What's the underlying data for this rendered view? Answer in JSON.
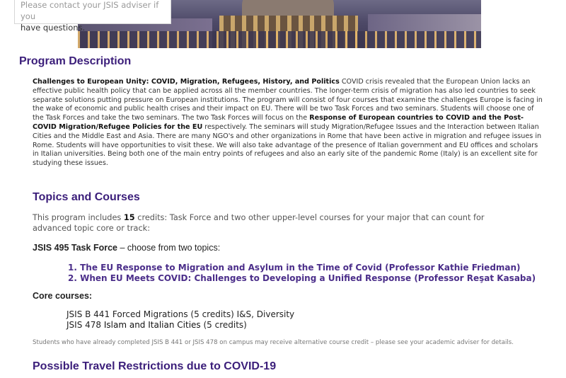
{
  "notice": {
    "line1": "Please contact your JSIS adviser if you",
    "line2": "have questions."
  },
  "program": {
    "title": "Program Description",
    "description": {
      "lead": "Challenges to European Unity: COVID, Migration, Refugees, History, and Politics",
      "p1": " COVID crisis revealed that the European Union lacks an effective public health policy that can be applied across all the member countries. The longer-term crisis of migration has also led countries to seek separate solutions putting pressure on European institutions. The program will consist of four courses that examine the challenges Europe is facing in the wake of economic and public health crises and their impact on EU. There will be two Task Forces and two seminars. Students will choose one of the Task Forces and take the two seminars. The two Task Forces will focus on the ",
      "bold2": "Response of European countries to COVID and the Post-COVID Migration/Refugee Policies for the EU",
      "p2": " respectively. The seminars will study Migration/Refugee Issues and the Interaction between Italian Cities and the Middle East and Asia. There are many NGO's and other organizations in Rome that have been active in migration and refugee issues in Rome. Students will have opportunities to visit these. We will also take advantage of the presence of Italian government and EU offices and scholars in Italian universities. Being both one of the main entry points of refugees and also an early site of the pandemic Rome (Italy) is an excellent site for studying these issues."
    }
  },
  "topics": {
    "heading": "Topics and Courses",
    "intro_pre": "This program includes ",
    "intro_credits": "15",
    "intro_post": " credits: Task Force and two other upper-level courses for your major that can count for advanced topic core or track:",
    "taskforce_bold": "JSIS 495 Task Force",
    "taskforce_rest": " – choose from two topics:",
    "list": [
      "1. The EU Response to Migration and Asylum in the Time of Covid (Professor Kathie Friedman)",
      "2. When EU Meets COVID: Challenges to Developing a Unified Response (Professor Reşat Kasaba)"
    ],
    "core_heading": "Core courses:",
    "core1": "JSIS B 441 Forced Migrations  (5 credits) I&S, Diversity",
    "core2_code": "JSIS 478 ",
    "core2_title": "Islam and Italian Cities",
    "core2_credits": " (5 credits)",
    "note": "Students who have already completed JSIS B 441 or JSIS 478 on campus may receive alternative course credit – please see your academic adviser for details."
  },
  "travel": {
    "heading": "Possible Travel Restrictions due to COVID-19"
  }
}
